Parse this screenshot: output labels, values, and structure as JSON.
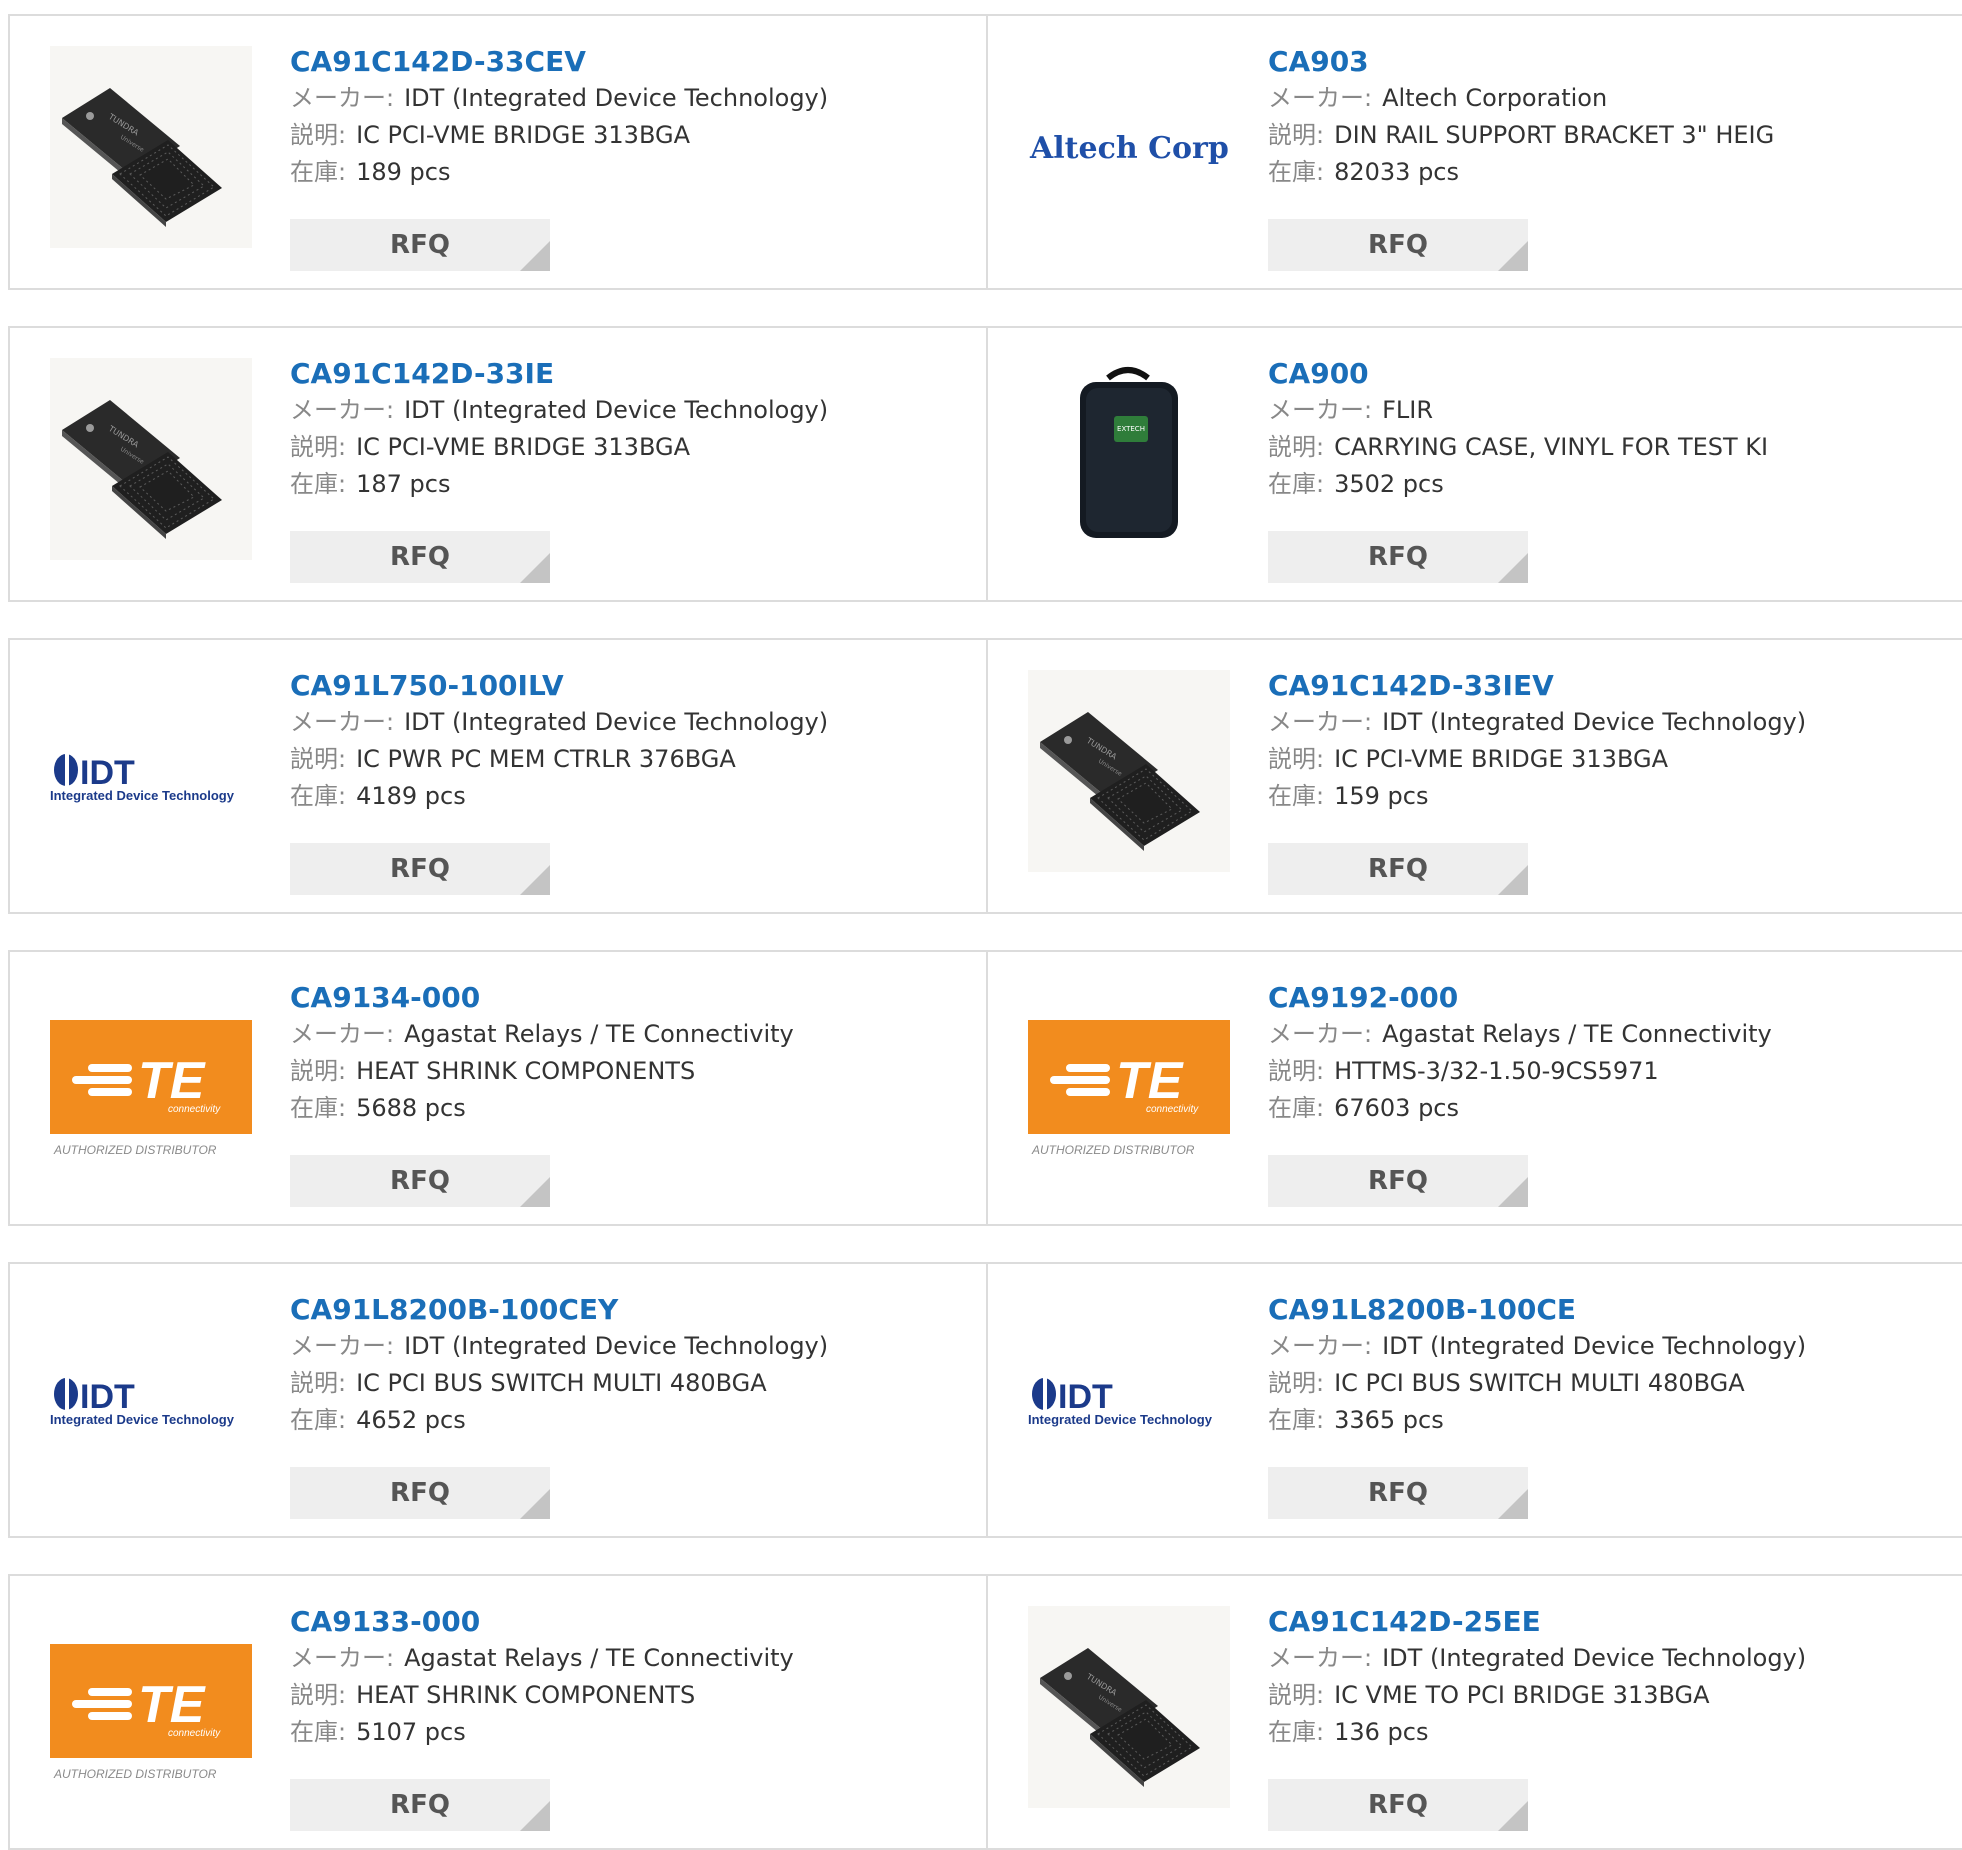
{
  "labels": {
    "maker": "メーカー:",
    "desc": "説明:",
    "stock": "在庫:",
    "rfq": "RFQ"
  },
  "logos": {
    "altech": "Altech Corp.",
    "idt_mark": "IDT",
    "idt_sub": "Integrated Device Technology",
    "te_mark": "TE",
    "te_sub": "connectivity",
    "te_tag": "AUTHORIZED DISTRIBUTOR",
    "chip_text": "TUNDRA",
    "chip_text2": "Universe",
    "case_text": "EXTECH"
  },
  "products": [
    {
      "part": "CA91C142D-33CEV",
      "maker": "IDT (Integrated Device Technology)",
      "desc": "IC PCI-VME BRIDGE 313BGA",
      "stock": "189 pcs",
      "image": "chip"
    },
    {
      "part": "CA903",
      "maker": "Altech Corporation",
      "desc": "DIN RAIL SUPPORT BRACKET 3\" HEIG",
      "stock": "82033 pcs",
      "image": "altech"
    },
    {
      "part": "CA91C142D-33IE",
      "maker": "IDT (Integrated Device Technology)",
      "desc": "IC PCI-VME BRIDGE 313BGA",
      "stock": "187 pcs",
      "image": "chip"
    },
    {
      "part": "CA900",
      "maker": "FLIR",
      "desc": "CARRYING CASE, VINYL FOR TEST KI",
      "stock": "3502 pcs",
      "image": "case"
    },
    {
      "part": "CA91L750-100ILV",
      "maker": "IDT (Integrated Device Technology)",
      "desc": "IC PWR PC MEM CTRLR 376BGA",
      "stock": "4189 pcs",
      "image": "idt"
    },
    {
      "part": "CA91C142D-33IEV",
      "maker": "IDT (Integrated Device Technology)",
      "desc": "IC PCI-VME BRIDGE 313BGA",
      "stock": "159 pcs",
      "image": "chip"
    },
    {
      "part": "CA9134-000",
      "maker": "Agastat Relays / TE Connectivity",
      "desc": "HEAT SHRINK COMPONENTS",
      "stock": "5688 pcs",
      "image": "te"
    },
    {
      "part": "CA9192-000",
      "maker": "Agastat Relays / TE Connectivity",
      "desc": "HTTMS-3/32-1.50-9CS5971",
      "stock": "67603 pcs",
      "image": "te"
    },
    {
      "part": "CA91L8200B-100CEY",
      "maker": "IDT (Integrated Device Technology)",
      "desc": "IC PCI BUS SWITCH MULTI 480BGA",
      "stock": "4652 pcs",
      "image": "idt"
    },
    {
      "part": "CA91L8200B-100CE",
      "maker": "IDT (Integrated Device Technology)",
      "desc": "IC PCI BUS SWITCH MULTI 480BGA",
      "stock": "3365 pcs",
      "image": "idt"
    },
    {
      "part": "CA9133-000",
      "maker": "Agastat Relays / TE Connectivity",
      "desc": "HEAT SHRINK COMPONENTS",
      "stock": "5107 pcs",
      "image": "te"
    },
    {
      "part": "CA91C142D-25EE",
      "maker": "IDT (Integrated Device Technology)",
      "desc": "IC VME TO PCI BRIDGE 313BGA",
      "stock": "136 pcs",
      "image": "chip"
    }
  ]
}
